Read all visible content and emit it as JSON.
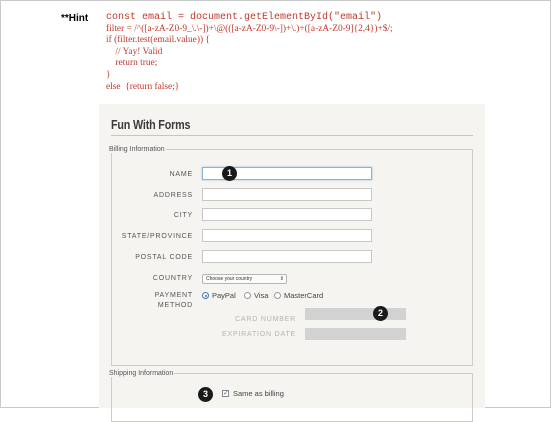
{
  "hint": {
    "label": "**Hint",
    "lines": [
      "const email = document.getElementById(\"email\")",
      "filter = /^([a-zA-Z0-9_\\.\\-])+\\@(([a-zA-Z0-9\\-])+\\.)+([a-zA-Z0-9]{2,4})+$/;",
      "if (filter.test(email.value)) {",
      "    // Yay! Valid",
      "    return true;",
      "}",
      "else  {return false;}"
    ]
  },
  "form": {
    "title": "Fun With Forms",
    "billing": {
      "legend": "Billing Information",
      "name_label": "NAME",
      "address_label": "ADDRESS",
      "city_label": "CITY",
      "state_label": "STATE/PROVINCE",
      "postal_label": "POSTAL CODE",
      "country_label": "COUNTRY",
      "country_value": "Choose your country",
      "payment_label_1": "PAYMENT",
      "payment_label_2": "METHOD",
      "payment_options": [
        "PayPal",
        "Visa",
        "MasterCard"
      ],
      "payment_selected": "PayPal",
      "card_number_label": "CARD NUMBER",
      "expiration_label": "EXPIRATION DATE"
    },
    "shipping": {
      "legend": "Shipping Information",
      "same_as_billing": "Same as billing",
      "same_as_billing_checked": true
    },
    "badges": [
      "1",
      "2",
      "3"
    ]
  },
  "colors": {
    "code": "#c0392b",
    "card_background": "#f5f4f0",
    "badge": "#1a1a1a",
    "accent": "#3f73b8"
  }
}
